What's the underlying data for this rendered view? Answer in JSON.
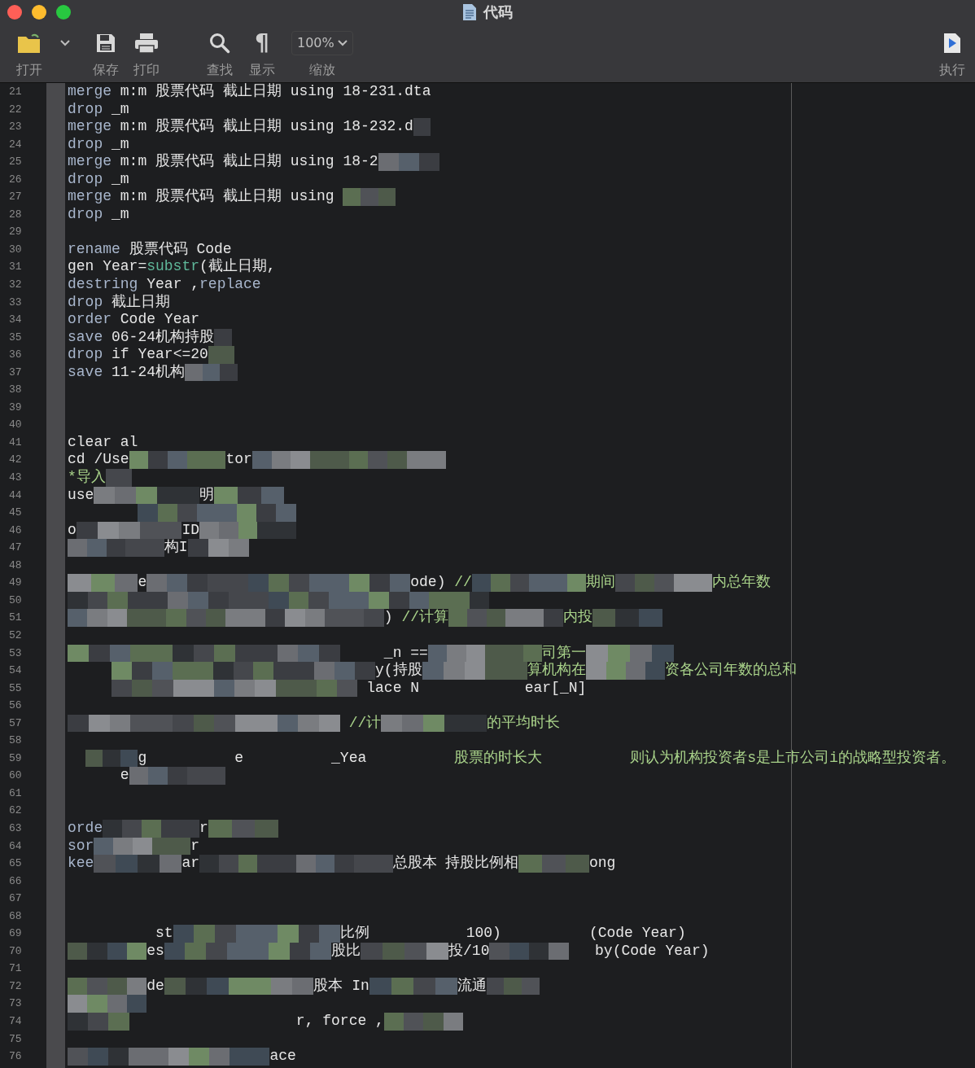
{
  "window": {
    "title": "代码"
  },
  "toolbar": [
    {
      "kind": "open",
      "label": "打开"
    },
    {
      "kind": "caret"
    },
    {
      "kind": "save",
      "label": "保存"
    },
    {
      "kind": "print",
      "label": "打印"
    },
    {
      "kind": "find",
      "label": "查找"
    },
    {
      "kind": "show",
      "glyph": "¶",
      "label": "显示"
    },
    {
      "kind": "zoom",
      "value": "100%",
      "label": "缩放"
    },
    {
      "kind": "run",
      "label": "执行"
    }
  ],
  "editor": {
    "lines": [
      {
        "number": "21",
        "segments": [
          {
            "kind": "command",
            "text": "merge"
          },
          {
            "kind": "plain",
            "text": " m:m 股票代码 截止日期 using 18-231.dta"
          }
        ]
      },
      {
        "number": "22",
        "segments": [
          {
            "kind": "command",
            "text": "drop"
          },
          {
            "kind": "plain",
            "text": " _m"
          }
        ]
      },
      {
        "number": "23",
        "segments": [
          {
            "kind": "command",
            "text": "merge"
          },
          {
            "kind": "plain",
            "text": " m:m 股票代码 截止日期 using 18-232.d"
          },
          {
            "kind": "mosaic"
          }
        ]
      },
      {
        "number": "24",
        "segments": [
          {
            "kind": "command",
            "text": "drop"
          },
          {
            "kind": "plain",
            "text": " _m"
          }
        ]
      },
      {
        "number": "25",
        "segments": [
          {
            "kind": "command",
            "text": "merge"
          },
          {
            "kind": "plain",
            "text": " m:m 股票代码 截止日期 using 18-2"
          },
          {
            "kind": "mosaic"
          }
        ]
      },
      {
        "number": "26",
        "segments": [
          {
            "kind": "command",
            "text": "drop"
          },
          {
            "kind": "plain",
            "text": " _m"
          }
        ]
      },
      {
        "number": "27",
        "segments": [
          {
            "kind": "command",
            "text": "merge"
          },
          {
            "kind": "plain",
            "text": " m:m 股票代码 截止日期 using"
          },
          {
            "kind": "blank"
          },
          {
            "kind": "mosaic"
          }
        ]
      },
      {
        "number": "28",
        "segments": [
          {
            "kind": "command",
            "text": "drop"
          },
          {
            "kind": "plain",
            "text": " _m"
          }
        ]
      },
      {
        "number": "29"
      },
      {
        "number": "30",
        "segments": [
          {
            "kind": "command",
            "text": "rename"
          },
          {
            "kind": "plain",
            "text": " 股票代码 Code"
          }
        ]
      },
      {
        "number": "31",
        "segments": [
          {
            "kind": "plain",
            "text": "gen Year="
          },
          {
            "kind": "function",
            "text": "substr"
          },
          {
            "kind": "plain",
            "text": "(截止日期,"
          }
        ]
      },
      {
        "number": "32",
        "segments": [
          {
            "kind": "command",
            "text": "destring"
          },
          {
            "kind": "plain",
            "text": " Year ,"
          },
          {
            "kind": "command",
            "text": "replace"
          }
        ]
      },
      {
        "number": "33",
        "segments": [
          {
            "kind": "command",
            "text": "drop"
          },
          {
            "kind": "plain",
            "text": " 截止日期"
          }
        ]
      },
      {
        "number": "34",
        "segments": [
          {
            "kind": "command",
            "text": "order"
          },
          {
            "kind": "plain",
            "text": " Code Year"
          }
        ]
      },
      {
        "number": "35",
        "segments": [
          {
            "kind": "command",
            "text": "save"
          },
          {
            "kind": "plain",
            "text": " 06-24机构持股"
          },
          {
            "kind": "mosaic"
          }
        ]
      },
      {
        "number": "36",
        "segments": [
          {
            "kind": "command",
            "text": "drop"
          },
          {
            "kind": "plain",
            "text": " if Year<=20"
          },
          {
            "kind": "mosaic"
          }
        ]
      },
      {
        "number": "37",
        "segments": [
          {
            "kind": "command",
            "text": "save"
          },
          {
            "kind": "plain",
            "text": " 11-24机构"
          },
          {
            "kind": "mosaic"
          }
        ]
      },
      {
        "number": "38"
      },
      {
        "number": "39"
      },
      {
        "number": "40"
      },
      {
        "number": "41",
        "segments": [
          {
            "kind": "plain",
            "text": "clear al"
          }
        ]
      },
      {
        "number": "42",
        "segments": [
          {
            "kind": "plain",
            "text": "cd /Use"
          },
          {
            "kind": "mosaic"
          },
          {
            "kind": "plain",
            "text": "tor"
          },
          {
            "kind": "mosaic"
          }
        ]
      },
      {
        "number": "43",
        "segments": [
          {
            "kind": "comment",
            "text": "*导入"
          },
          {
            "kind": "mosaic"
          }
        ]
      },
      {
        "number": "44",
        "segments": [
          {
            "kind": "plain",
            "text": "use"
          },
          {
            "kind": "mosaic"
          },
          {
            "kind": "plain",
            "text": "明"
          },
          {
            "kind": "mosaic"
          }
        ]
      },
      {
        "number": "45",
        "segments": [
          {
            "kind": "blank"
          },
          {
            "kind": "mosaic"
          }
        ]
      },
      {
        "number": "46",
        "segments": [
          {
            "kind": "plain",
            "text": "o"
          },
          {
            "kind": "mosaic"
          },
          {
            "kind": "plain",
            "text": "ID"
          },
          {
            "kind": "mosaic"
          }
        ]
      },
      {
        "number": "47",
        "segments": [
          {
            "kind": "mosaic"
          },
          {
            "kind": "plain",
            "text": "构I"
          },
          {
            "kind": "mosaic"
          }
        ]
      },
      {
        "number": "48"
      },
      {
        "number": "49",
        "segments": [
          {
            "kind": "mosaic"
          },
          {
            "kind": "plain",
            "text": "e"
          },
          {
            "kind": "mosaic"
          },
          {
            "kind": "plain",
            "text": "ode) "
          },
          {
            "kind": "comment",
            "text": "//"
          },
          {
            "kind": "mosaic"
          },
          {
            "kind": "comment",
            "text": "期间"
          },
          {
            "kind": "mosaic"
          },
          {
            "kind": "comment",
            "text": "内总年数"
          }
        ]
      },
      {
        "number": "50",
        "segments": [
          {
            "kind": "mosaic"
          }
        ]
      },
      {
        "number": "51",
        "segments": [
          {
            "kind": "mosaic"
          },
          {
            "kind": "plain",
            "text": ")"
          },
          {
            "kind": "comment",
            "text": " //计算"
          },
          {
            "kind": "mosaic"
          },
          {
            "kind": "comment",
            "text": "内投"
          },
          {
            "kind": "mosaic"
          }
        ]
      },
      {
        "number": "52"
      },
      {
        "number": "53",
        "segments": [
          {
            "kind": "mosaic"
          },
          {
            "kind": "plain",
            "text": "     _n =="
          },
          {
            "kind": "mosaic"
          },
          {
            "kind": "comment",
            "text": "司第一"
          },
          {
            "kind": "mosaic"
          }
        ]
      },
      {
        "number": "54",
        "segments": [
          {
            "kind": "blank"
          },
          {
            "kind": "mosaic"
          },
          {
            "kind": "plain",
            "text": "y(持股"
          },
          {
            "kind": "mosaic"
          },
          {
            "kind": "comment",
            "text": "算机构在"
          },
          {
            "kind": "mosaic"
          },
          {
            "kind": "comment",
            "text": "资各公司年数的总和"
          }
        ]
      },
      {
        "number": "55",
        "segments": [
          {
            "kind": "blank"
          },
          {
            "kind": "mosaic"
          },
          {
            "kind": "plain",
            "text": " lace N            ear[_N]"
          }
        ]
      },
      {
        "number": "56"
      },
      {
        "number": "57",
        "segments": [
          {
            "kind": "mosaic"
          },
          {
            "kind": "comment",
            "text": " //计"
          },
          {
            "kind": "mosaic"
          },
          {
            "kind": "comment",
            "text": "的平均时长"
          }
        ]
      },
      {
        "number": "58"
      },
      {
        "number": "59",
        "segments": [
          {
            "kind": "blank"
          },
          {
            "kind": "mosaic"
          },
          {
            "kind": "plain",
            "text": "g          e          _Yea"
          },
          {
            "kind": "comment",
            "text": "          股票的时长大          则认为机构投资者s是上市公司i的战略型投资者。"
          }
        ]
      },
      {
        "number": "60",
        "segments": [
          {
            "kind": "plain",
            "text": "      e"
          },
          {
            "kind": "mosaic"
          }
        ]
      },
      {
        "number": "61"
      },
      {
        "number": "62"
      },
      {
        "number": "63",
        "segments": [
          {
            "kind": "command",
            "text": "orde"
          },
          {
            "kind": "mosaic"
          },
          {
            "kind": "plain",
            "text": "r"
          },
          {
            "kind": "mosaic"
          }
        ]
      },
      {
        "number": "64",
        "segments": [
          {
            "kind": "command",
            "text": "sor"
          },
          {
            "kind": "mosaic"
          },
          {
            "kind": "plain",
            "text": "r"
          }
        ]
      },
      {
        "number": "65",
        "segments": [
          {
            "kind": "command",
            "text": "kee"
          },
          {
            "kind": "mosaic"
          },
          {
            "kind": "plain",
            "text": "ar"
          },
          {
            "kind": "mosaic"
          },
          {
            "kind": "plain",
            "text": "总股本 持股比例相"
          },
          {
            "kind": "mosaic"
          },
          {
            "kind": "plain",
            "text": "ong"
          }
        ]
      },
      {
        "number": "66"
      },
      {
        "number": "67"
      },
      {
        "number": "68"
      },
      {
        "number": "69",
        "segments": [
          {
            "kind": "plain",
            "text": "          st"
          },
          {
            "kind": "mosaic"
          },
          {
            "kind": "plain",
            "text": "比例           100)          (Code Year)"
          }
        ]
      },
      {
        "number": "70",
        "segments": [
          {
            "kind": "mosaic"
          },
          {
            "kind": "plain",
            "text": "es"
          },
          {
            "kind": "mosaic"
          },
          {
            "kind": "plain",
            "text": "股比"
          },
          {
            "kind": "mosaic"
          },
          {
            "kind": "plain",
            "text": "投/10"
          },
          {
            "kind": "mosaic"
          },
          {
            "kind": "plain",
            "text": "   by(Code Year)"
          }
        ]
      },
      {
        "number": "71"
      },
      {
        "number": "72",
        "segments": [
          {
            "kind": "mosaic"
          },
          {
            "kind": "plain",
            "text": "de"
          },
          {
            "kind": "mosaic"
          },
          {
            "kind": "plain",
            "text": "股本 In"
          },
          {
            "kind": "mosaic"
          },
          {
            "kind": "plain",
            "text": "流通"
          },
          {
            "kind": "mosaic"
          }
        ]
      },
      {
        "number": "73",
        "segments": [
          {
            "kind": "mosaic"
          }
        ]
      },
      {
        "number": "74",
        "segments": [
          {
            "kind": "mosaic"
          },
          {
            "kind": "plain",
            "text": "                   r, force ,"
          },
          {
            "kind": "mosaic"
          }
        ]
      },
      {
        "number": "75"
      },
      {
        "number": "76",
        "segments": [
          {
            "kind": "mosaic"
          },
          {
            "kind": "plain",
            "text": "ace"
          }
        ]
      }
    ]
  }
}
